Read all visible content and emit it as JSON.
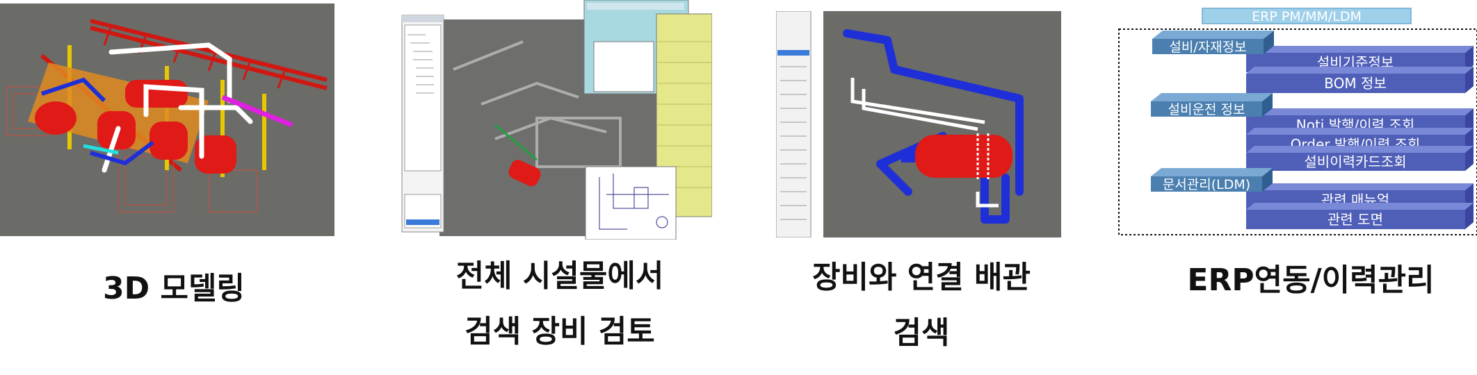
{
  "captions": {
    "modeling": "3D 모델링",
    "search_review_line1": "전체 시설물에서",
    "search_review_line2": "검색 장비 검토",
    "piping_line1": "장비와 연결 배관",
    "piping_line2": "검색",
    "erp": "ERP연동/이력관리"
  },
  "erp_diagram": {
    "title": "ERP PM/MM/LDM",
    "groups": [
      {
        "header": "설비/자재정보",
        "items": [
          "설비기준정보",
          "BOM 정보"
        ]
      },
      {
        "header": "설비운전 정보",
        "items": [
          "Noti 발행/이력 조회",
          "Order 발행/이력 조회",
          "설비이력카드조회"
        ]
      },
      {
        "header": "문서관리(LDM)",
        "items": [
          "관련 매뉴얼",
          "관련 도면"
        ]
      }
    ]
  },
  "colors": {
    "viewport_bg": "#6b6b68",
    "pipe_red": "#e01a16",
    "pipe_blue": "#1f2fd8",
    "pipe_yellow": "#e8c800",
    "header_bar": "#4a7fb0",
    "item_bar": "#4f5fb8",
    "title_bar": "#9fd0ea"
  }
}
